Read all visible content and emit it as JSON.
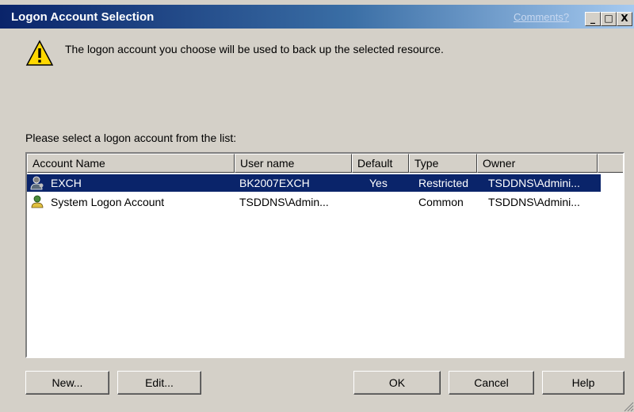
{
  "window": {
    "title": "Logon Account Selection",
    "comments_link": "Comments?",
    "controls": {
      "minimize": "_",
      "maximize": "□",
      "close": "X"
    }
  },
  "message": {
    "icon": "warning-icon",
    "text": "The logon account you choose will be used to back up the selected resource."
  },
  "list": {
    "label": "Please select a logon account from the list:",
    "columns": [
      "Account Name",
      "User name",
      "Default",
      "Type",
      "Owner"
    ],
    "rows": [
      {
        "icon": "user-key-icon",
        "account": "EXCH",
        "user": "BK2007EXCH",
        "default": "Yes",
        "type": "Restricted",
        "owner": "TSDDNS\\Admini...",
        "selected": true
      },
      {
        "icon": "system-user-icon",
        "account": "System Logon Account",
        "user": "TSDDNS\\Admin...",
        "default": "",
        "type": "Common",
        "owner": "TSDDNS\\Admini...",
        "selected": false
      }
    ]
  },
  "buttons": {
    "new": "New...",
    "edit": "Edit...",
    "ok": "OK",
    "cancel": "Cancel",
    "help": "Help"
  },
  "colors": {
    "title_bar": "#0a246a",
    "selection": "#0a246a",
    "face": "#d4d0c8"
  }
}
